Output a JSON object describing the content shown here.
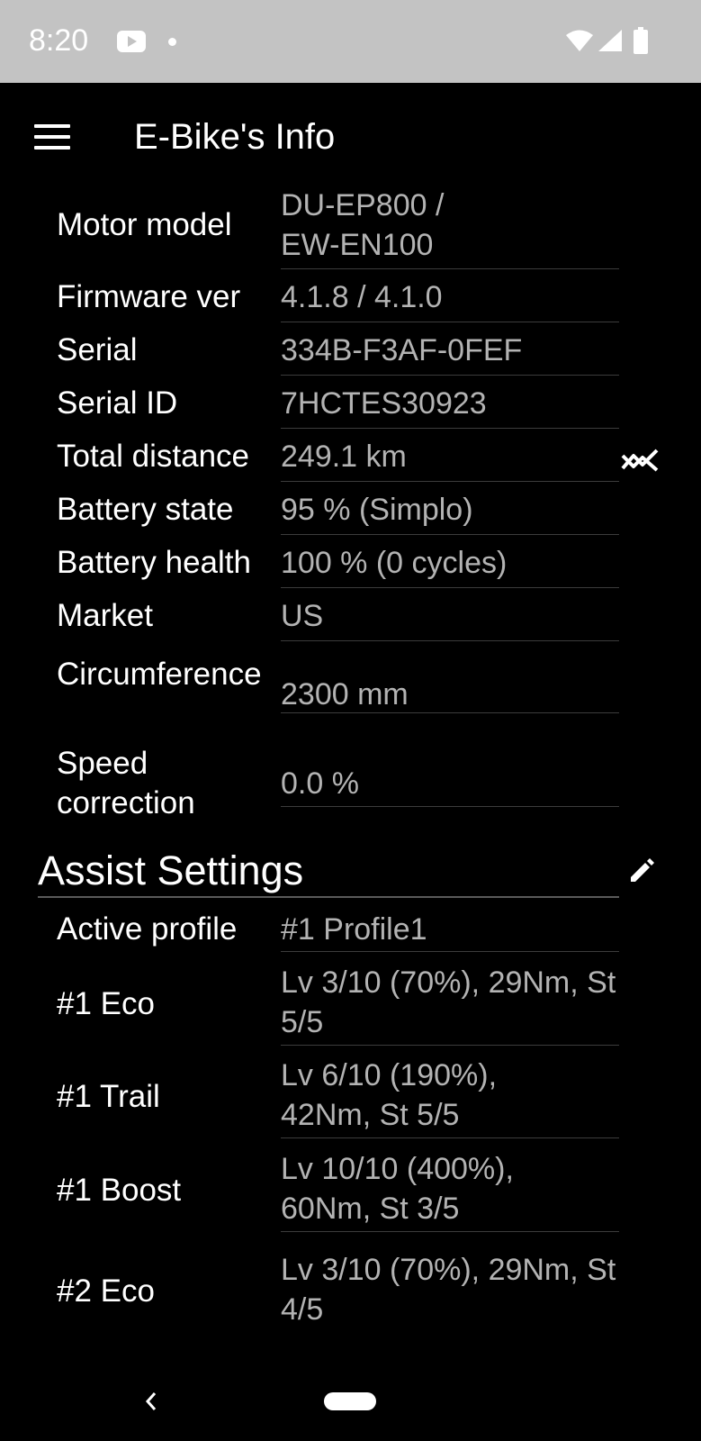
{
  "status_bar": {
    "time": "8:20",
    "icons": [
      "youtube-icon",
      "notification-dot-icon",
      "wifi-icon",
      "signal-icon",
      "battery-icon"
    ]
  },
  "app_bar": {
    "title": "E-Bike's Info",
    "menu_icon": "hamburger-menu-icon"
  },
  "info": {
    "motor_model": {
      "label": "Motor model",
      "value": "DU-EP800 / EW-EN100"
    },
    "firmware": {
      "label": "Firmware ver",
      "value": "4.1.8 / 4.1.0"
    },
    "serial": {
      "label": "Serial",
      "value": "334B-F3AF-0FEF"
    },
    "serial_id": {
      "label": "Serial ID",
      "value": "7HCTES30923"
    },
    "total_distance": {
      "label": "Total distance",
      "value": "249.1 km",
      "action_icon": "trending-chart-icon"
    },
    "battery_state": {
      "label": "Battery state",
      "value": "95 % (Simplo)"
    },
    "battery_health": {
      "label": "Battery health",
      "value": "100 % (0 cycles)"
    },
    "market": {
      "label": "Market",
      "value": "US"
    },
    "circumference": {
      "label": "Circumference",
      "value": "2300 mm"
    },
    "speed_correction": {
      "label": "Speed correction",
      "value": "0.0 %"
    }
  },
  "assist": {
    "title": "Assist Settings",
    "edit_icon": "pencil-icon",
    "active_profile": {
      "label": "Active profile",
      "value": "#1 Profile1"
    },
    "eco1": {
      "label": "#1 Eco",
      "value": "Lv 3/10 (70%), 29Nm, St 5/5"
    },
    "trail1": {
      "label": "#1 Trail",
      "value": "Lv 6/10 (190%), 42Nm, St 5/5"
    },
    "boost1": {
      "label": "#1 Boost",
      "value": "Lv 10/10 (400%), 60Nm, St 3/5"
    },
    "eco2": {
      "label": "#2 Eco",
      "value": "Lv 3/10 (70%), 29Nm, St 4/5"
    }
  },
  "nav_bar": {
    "icons": [
      "back-icon",
      "home-pill-icon"
    ]
  },
  "colors": {
    "background": "#000000",
    "status_bar": "#c3c3c3",
    "label_text": "#ffffff",
    "value_text": "#b3b3b3",
    "divider": "#3c3c3c"
  }
}
